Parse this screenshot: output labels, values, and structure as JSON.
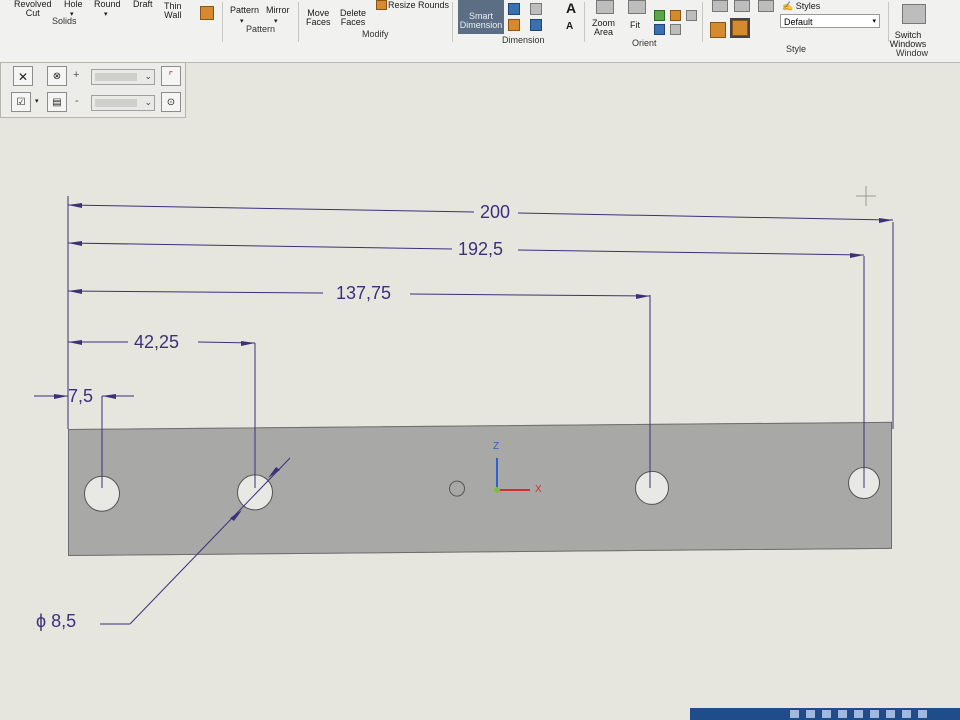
{
  "ribbon": {
    "solids": {
      "revolved_cut": "Revolved\nCut",
      "hole": "Hole",
      "round": "Round",
      "draft": "Draft",
      "thin_wall": "Thin\nWall",
      "group": "Solids"
    },
    "pattern": {
      "pattern": "Pattern",
      "mirror": "Mirror",
      "group": "Pattern"
    },
    "modify": {
      "move_faces": "Move\nFaces",
      "delete_faces": "Delete\nFaces",
      "resize_rounds": "Resize Rounds",
      "group": "Modify"
    },
    "dimension": {
      "smart_dimension": "Smart\nDimension",
      "group": "Dimension"
    },
    "orient": {
      "zoom_area": "Zoom\nArea",
      "fit": "Fit",
      "group": "Orient"
    },
    "style": {
      "styles_label": "Styles",
      "style_value": "Default",
      "group": "Style"
    },
    "window": {
      "switch_windows": "Switch\nWindows",
      "group": "Window"
    }
  },
  "command_bar": {
    "plus": "+",
    "minus": "-"
  },
  "drawing": {
    "dimensions": {
      "overall": "200",
      "hole4": "192,5",
      "hole3": "137,75",
      "hole2": "42,25",
      "hole1": "7,5",
      "diameter": "8,5",
      "diameter_symbol": "ϕ"
    },
    "axes": {
      "z": "Z",
      "x": "X"
    }
  },
  "colors": {
    "dimension": "#3d2f7a",
    "part_fill": "#a8a8a6",
    "sheet": "#e6e6df",
    "axis_z": "#2f5fd0",
    "axis_x": "#d23030"
  }
}
